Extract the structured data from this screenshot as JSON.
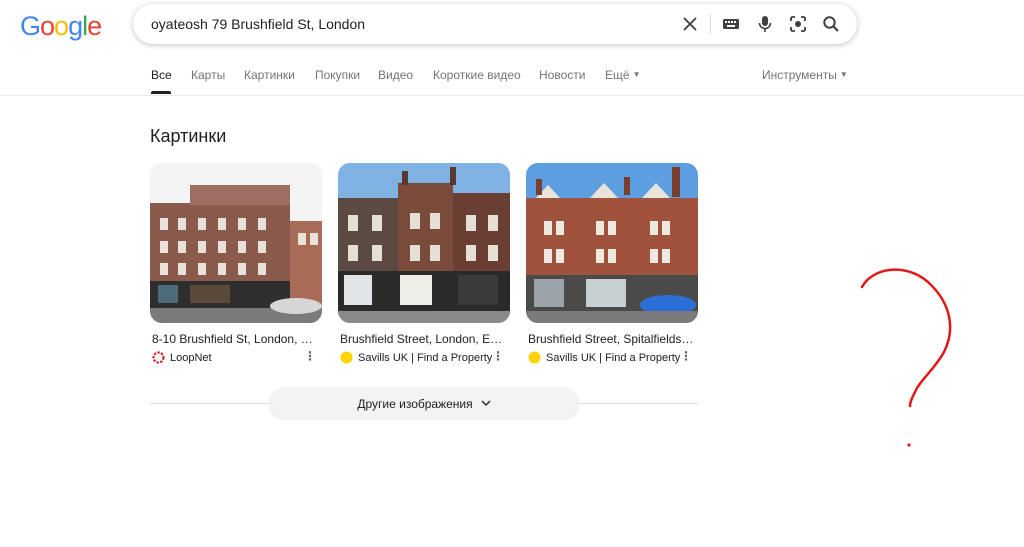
{
  "logo": {
    "letters": [
      "G",
      "o",
      "o",
      "g",
      "l",
      "e"
    ],
    "colors": [
      "#4285F4",
      "#EA4335",
      "#FBBC05",
      "#4285F4",
      "#34A853",
      "#EA4335"
    ]
  },
  "search": {
    "query": "oyateosh 79 Brushfield St, London",
    "icons": [
      "close-icon",
      "keyboard-icon",
      "microphone-icon",
      "lens-icon",
      "search-icon"
    ]
  },
  "tabs": {
    "all": "Все",
    "maps": "Карты",
    "images": "Картинки",
    "shopping": "Покупки",
    "videos": "Видео",
    "short_videos": "Короткие видео",
    "news": "Новости",
    "more": "Ещё",
    "tools": "Инструменты"
  },
  "images_section": {
    "title": "Картинки",
    "cards": [
      {
        "title": "8-10 Brushfield St, London, E...",
        "source": "LoopNet",
        "source_color": "#E0202C"
      },
      {
        "title": "Brushfield Street, London, E1...",
        "source": "Savills UK | Find a Property",
        "source_color": "#FFD400"
      },
      {
        "title": "Brushfield Street, Spitalfields,...",
        "source": "Savills UK | Find a Property",
        "source_color": "#FFD400"
      }
    ],
    "more_button": "Другие изображения"
  },
  "colors": {
    "annotation": "#E01818",
    "accent_text": "#202124",
    "muted_text": "#70757a"
  }
}
